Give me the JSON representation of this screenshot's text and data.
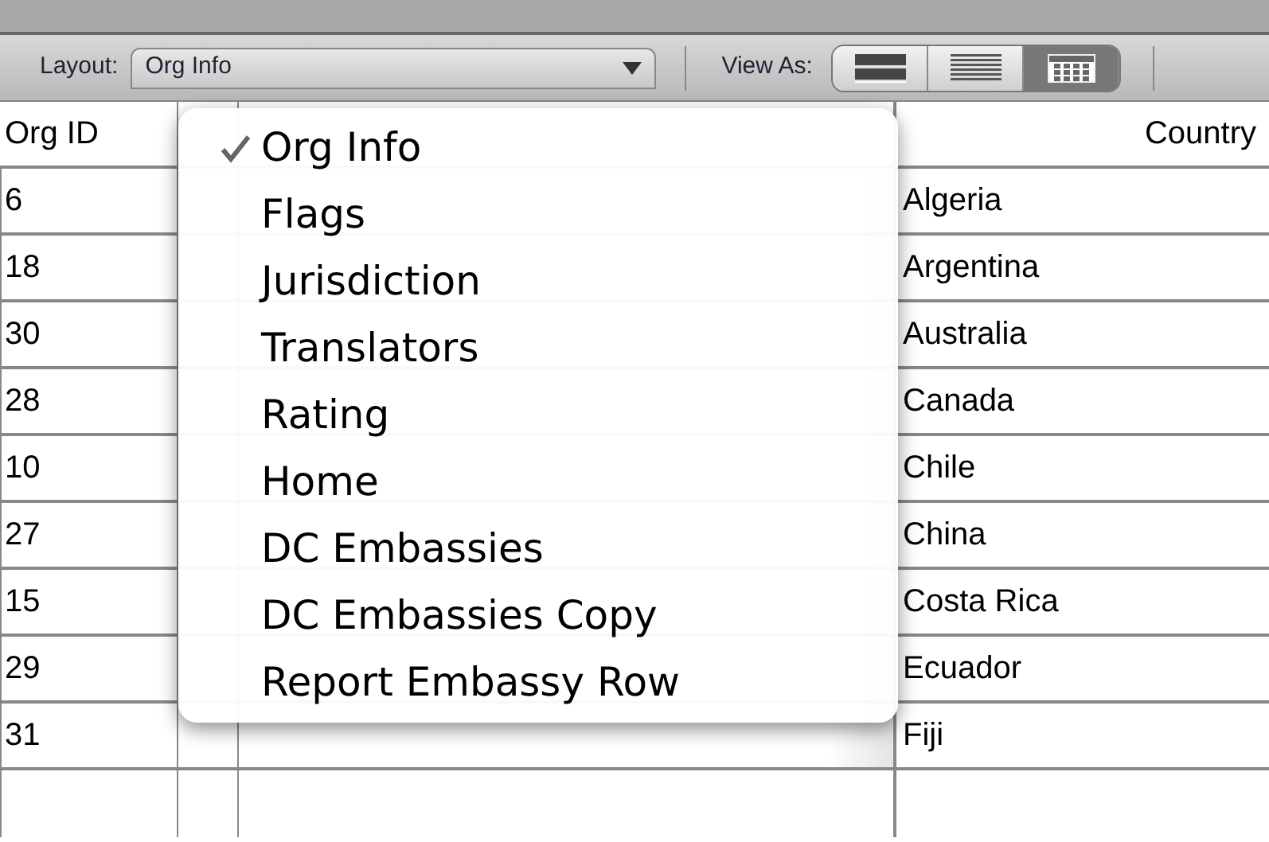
{
  "toolbar": {
    "layout_label": "Layout:",
    "layout_value": "Org Info",
    "view_as_label": "View As:",
    "view_modes": [
      {
        "kind": "form",
        "selected": false
      },
      {
        "kind": "list",
        "selected": false
      },
      {
        "kind": "table",
        "selected": true
      }
    ]
  },
  "table": {
    "columns": [
      "Org ID",
      "Country"
    ],
    "rows": [
      {
        "org_id": "6",
        "country": "Algeria"
      },
      {
        "org_id": "18",
        "country": "Argentina"
      },
      {
        "org_id": "30",
        "country": "Australia"
      },
      {
        "org_id": "28",
        "country": "Canada"
      },
      {
        "org_id": "10",
        "country": "Chile"
      },
      {
        "org_id": "27",
        "country": "China"
      },
      {
        "org_id": "15",
        "country": "Costa Rica"
      },
      {
        "org_id": "29",
        "country": "Ecuador"
      },
      {
        "org_id": "31",
        "country": "Fiji"
      }
    ]
  },
  "layout_menu": [
    {
      "label": "Org Info",
      "selected": true
    },
    {
      "label": "Flags",
      "selected": false
    },
    {
      "label": "Jurisdiction",
      "selected": false
    },
    {
      "label": "Translators",
      "selected": false
    },
    {
      "label": "Rating",
      "selected": false
    },
    {
      "label": "Home",
      "selected": false
    },
    {
      "label": "DC Embassies",
      "selected": false
    },
    {
      "label": "DC Embassies Copy",
      "selected": false
    },
    {
      "label": "Report Embassy Row",
      "selected": false
    }
  ]
}
